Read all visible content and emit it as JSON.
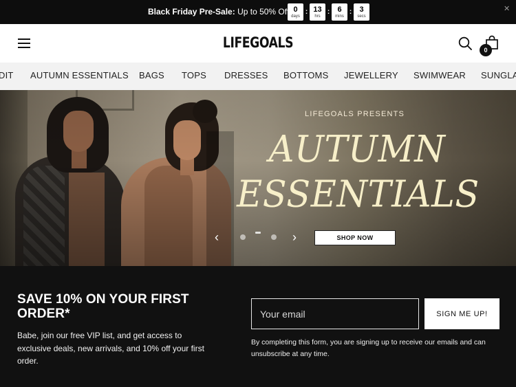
{
  "announcement": {
    "bold_text": "Black Friday Pre-Sale:",
    "text": " Up to 50% Off",
    "countdown": [
      {
        "value": "0",
        "unit": "days"
      },
      {
        "value": "13",
        "unit": "hrs"
      },
      {
        "value": "6",
        "unit": "mins"
      },
      {
        "value": "3",
        "unit": "secs"
      }
    ],
    "separator": ":",
    "close_icon": "close-icon"
  },
  "header": {
    "logo": "LIFEGOALS",
    "menu_icon": "hamburger-menu-icon",
    "search_icon": "search-icon",
    "cart_icon": "shopping-bag-icon",
    "cart_count": "0"
  },
  "nav": {
    "items": [
      {
        "label": "DIT"
      },
      {
        "label": "AUTUMN ESSENTIALS"
      },
      {
        "label": "BAGS"
      },
      {
        "label": "TOPS"
      },
      {
        "label": "DRESSES"
      },
      {
        "label": "BOTTOMS"
      },
      {
        "label": "JEWELLERY"
      },
      {
        "label": "SWIMWEAR"
      },
      {
        "label": "SUNGLA"
      }
    ]
  },
  "hero": {
    "eyebrow": "LIFEGOALS PRESENTS",
    "title_line1": "AUTUMN",
    "title_line2": "ESSENTIALS",
    "cta": "SHOP NOW",
    "prev": "‹",
    "next": "›",
    "slides": 3,
    "active_slide": 1,
    "title_color": "#f7efc9"
  },
  "newsletter": {
    "title": "SAVE 10% ON YOUR FIRST ORDER*",
    "description": "Babe, join our free VIP list, and get access to exclusive deals, new arrivals, and 10% off your first order.",
    "email_placeholder": "Your email",
    "email_value": "",
    "button": "SIGN ME UP!",
    "legal": "By completing this form, you are signing up to receive our emails and can unsubscribe at any time."
  }
}
